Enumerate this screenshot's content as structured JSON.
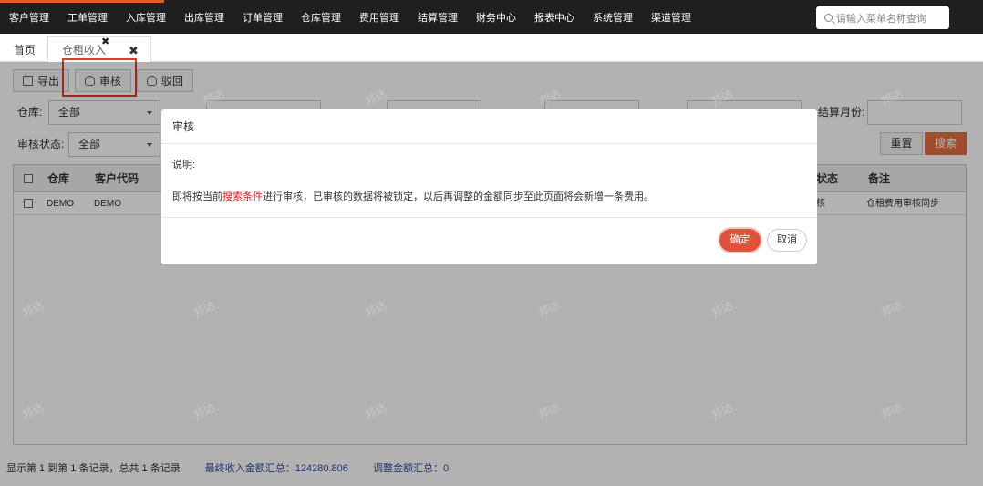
{
  "nav": {
    "items": [
      "客户管理",
      "工单管理",
      "入库管理",
      "出库管理",
      "订单管理",
      "仓库管理",
      "费用管理",
      "结算管理",
      "财务中心",
      "报表中心",
      "系统管理",
      "渠道管理"
    ],
    "search_placeholder": "请输入菜单名称查询"
  },
  "tabs": {
    "home": "首页",
    "active": "仓租收入",
    "close_glyph": "✖"
  },
  "toolbar": {
    "export": "导出",
    "audit": "审核",
    "reject": "驳回"
  },
  "filters": {
    "warehouse_label": "仓库:",
    "warehouse_value": "全部",
    "audit_status_label": "审核状态:",
    "audit_status_value": "全部",
    "settle_month_label": "结算月份:"
  },
  "actions": {
    "reset": "重置",
    "search": "搜索"
  },
  "grid": {
    "headers": {
      "warehouse": "仓库",
      "customer_code": "客户代码",
      "status": "状态",
      "remark": "备注"
    },
    "rows": [
      {
        "warehouse": "DEMO",
        "customer_code": "DEMO",
        "status": "核",
        "remark": "仓租费用审核同步"
      }
    ]
  },
  "footer": {
    "records": "显示第 1 到第 1 条记录，总共 1 条记录",
    "final_income": "最终收入金额汇总：124280.806",
    "adjust_total": "调整金额汇总：0"
  },
  "watermark_text": "邦达",
  "modal": {
    "title": "审核",
    "desc_label": "说明:",
    "text_before": "即将按当前",
    "text_highlight": "搜索条件",
    "text_after": "进行审核，已审核的数据将被锁定，以后再调整的金额同步至此页面将会新增一条费用。",
    "ok": "确定",
    "cancel": "取消"
  },
  "colors": {
    "nav_bg": "#1f1f1f",
    "accent": "#e8572f",
    "search_btn": "#e46f42",
    "ok_btn": "#e0523c",
    "highlight_border": "#e03a2a",
    "footer_link": "#2f4ba0"
  }
}
